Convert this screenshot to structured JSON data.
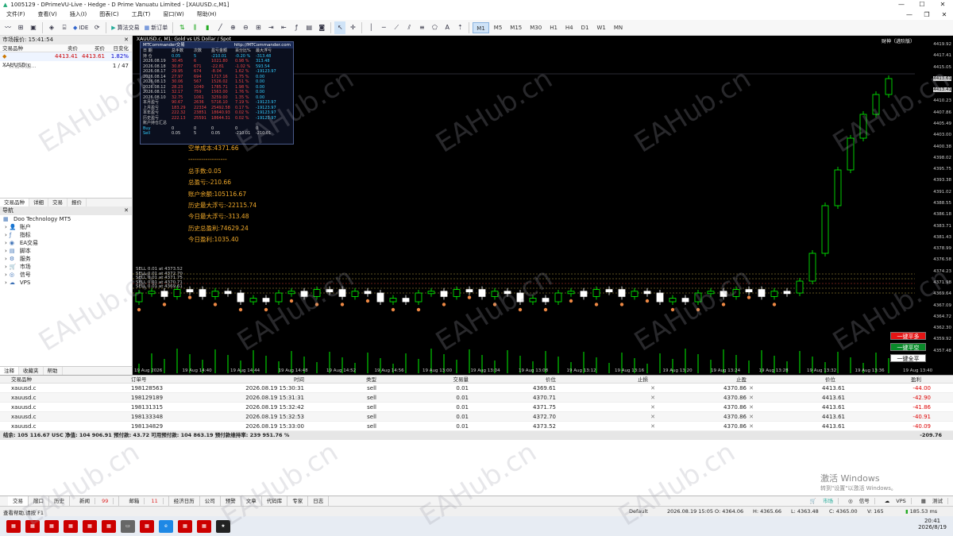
{
  "window": {
    "title": "1005129 - DPrimeVU-Live - Hedge - D Prime Vanuatu Limited - [XAUUSD.c,M1]"
  },
  "menu": [
    "文件(F)",
    "查看(V)",
    "插入(I)",
    "图表(C)",
    "工具(T)",
    "窗口(W)",
    "帮助(H)"
  ],
  "toolbar": {
    "ide": "IDE",
    "algo": "算法交易",
    "new_order": "新订单",
    "timeframes": [
      "M1",
      "M5",
      "M15",
      "M30",
      "H1",
      "H4",
      "D1",
      "W1",
      "MN"
    ]
  },
  "market_watch": {
    "header": "市场报价: 15:41:54",
    "cols": [
      "交易品种",
      "卖价",
      "买价",
      "日变化"
    ],
    "rows": [
      {
        "symbol": "XAUUSD.c",
        "bid": "4413.41",
        "ask": "4413.61",
        "change": "1.82%"
      }
    ],
    "add_label": "点击添加...",
    "count": "1 / 47",
    "tabs": [
      "交易品种",
      "详细",
      "交易",
      "报价"
    ]
  },
  "navigator": {
    "header": "导航",
    "items": [
      "Doo Technology MT5",
      "账户",
      "指标",
      "EA交易",
      "脚本",
      "服务",
      "市场",
      "信号",
      "VPS"
    ],
    "tabs": [
      "注释",
      "收藏夹",
      "帮助"
    ]
  },
  "chart": {
    "title": "XAUUSD.c, M1:  Gold vs US Dollar / Spot",
    "commander_title": "MTCommander交易",
    "commander_url": "http://MTCommander.com",
    "top_right_label": "财神（进阶版）",
    "commander_rows": [
      [
        "日 期",
        "总手数",
        "次数",
        "盈亏金额",
        "百分比%",
        "最大浮亏"
      ],
      [
        "持 仓",
        "0.05",
        "5",
        "-210.01",
        "-0.20 %",
        "-313.48"
      ],
      [
        "2026.08.19",
        "30.45",
        "6",
        "1021.80",
        "0.98 %",
        "313.48"
      ],
      [
        "2026.08.18",
        "30.87",
        "671",
        "-22.81",
        "-1.02 %",
        "593.54"
      ],
      [
        "2026.08.17",
        "29.95",
        "674",
        "-8.04",
        "1.62 %",
        "-19123.97"
      ],
      [
        "2026.08.14",
        "27.97",
        "694",
        "1717.16",
        "1.75 %",
        "0.00"
      ],
      [
        "2026.08.13",
        "30.06",
        "567",
        "1526.02",
        "1.51 %",
        "0.00"
      ],
      [
        "2026.08.12",
        "28.23",
        "1040",
        "1785.71",
        "1.98 %",
        "0.00"
      ],
      [
        "2026.08.11",
        "32.17",
        "759",
        "1563.00",
        "1.76 %",
        "0.00"
      ],
      [
        "2026.08.10",
        "32.75",
        "1061",
        "3259.00",
        "1.35 %",
        "0.00"
      ],
      [
        "本月盈亏",
        "90.67",
        "2636",
        "5716.10",
        "7.19 %",
        "-19123.97"
      ],
      [
        "上月盈亏",
        "183.29",
        "22334",
        "25492.58",
        "0.17 %",
        "-19123.97"
      ],
      [
        "本年盈亏",
        "222.32",
        "23851",
        "18640.93",
        "0.02 %",
        "-19123.97"
      ],
      [
        "历史盈亏",
        "222.13",
        "25591",
        "18644.31",
        "0.02 %",
        "-19123.97"
      ],
      [
        "账户持仓汇总",
        "",
        "",
        "",
        "",
        ""
      ],
      [
        "Buy",
        "0",
        "0",
        "0",
        "0",
        "0"
      ],
      [
        "Sell",
        "0.05",
        "5",
        "0.05",
        "-210.01",
        "-210.01"
      ]
    ],
    "summary": [
      "空单成本:4371.66",
      "------------------",
      "总手数:0.05",
      "总盈亏:-210.66",
      "账户余额:105116.67",
      "历史最大浮亏:-22115.74",
      "今日最大浮亏:-313.48",
      "历史总盈利:74629.24",
      "今日盈利:1035.40"
    ],
    "sell_tags": [
      "SELL 0.01 at 4373.52",
      "SELL 0.01 at 4372.70",
      "SELL 0.01 at 4371.75",
      "SELL 0.01 at 4370.71",
      "SELL 0.01 at 4369.61"
    ],
    "price_axis": [
      "4419.92",
      "4417.41",
      "4415.05",
      "4413.61",
      "4413.41",
      "4410.23",
      "4407.86",
      "4405.49",
      "4403.00",
      "4400.38",
      "4398.02",
      "4395.75",
      "4393.38",
      "4391.02",
      "4388.55",
      "4386.18",
      "4383.71",
      "4381.43",
      "4378.99",
      "4376.58",
      "4374.23",
      "4371.98",
      "4369.64",
      "4367.09",
      "4364.72",
      "4362.30",
      "4359.92",
      "4357.48"
    ],
    "time_axis": [
      "19 Aug 2026",
      "19 Aug 14:40",
      "19 Aug 14:44",
      "19 Aug 14:48",
      "19 Aug 14:52",
      "19 Aug 14:56",
      "19 Aug 13:00",
      "19 Aug 13:04",
      "19 Aug 13:08",
      "19 Aug 13:12",
      "19 Aug 13:16",
      "19 Aug 13:20",
      "19 Aug 13:24",
      "19 Aug 13:28",
      "19 Aug 13:32",
      "19 Aug 13:36",
      "19 Aug 13:40"
    ],
    "buttons": {
      "close_buy": "一键平多",
      "close_sell": "一键平空",
      "close_all": "一键全平"
    }
  },
  "trade": {
    "cols": [
      "交易品种",
      "订单号",
      "时间",
      "类型",
      "交易量",
      "价位",
      "止损",
      "止盈",
      "价位",
      "盈利"
    ],
    "rows": [
      [
        "xauusd.c",
        "198128563",
        "2026.08.19 15:30:31",
        "sell",
        "0.01",
        "4369.61",
        "",
        "4370.86",
        "4413.61",
        "-44.00"
      ],
      [
        "xauusd.c",
        "198129189",
        "2026.08.19 15:31:31",
        "sell",
        "0.01",
        "4370.71",
        "",
        "4370.86",
        "4413.61",
        "-42.90"
      ],
      [
        "xauusd.c",
        "198131315",
        "2026.08.19 15:32:42",
        "sell",
        "0.01",
        "4371.75",
        "",
        "4370.86",
        "4413.61",
        "-41.86"
      ],
      [
        "xauusd.c",
        "198133348",
        "2026.08.19 15:32:53",
        "sell",
        "0.01",
        "4372.70",
        "",
        "4370.86",
        "4413.61",
        "-40.91"
      ],
      [
        "xauusd.c",
        "198134829",
        "2026.08.19 15:33:00",
        "sell",
        "0.01",
        "4373.52",
        "",
        "4370.86",
        "4413.61",
        "-40.09"
      ]
    ],
    "footer": "结余: 105 116.67 USC  净值: 104 906.91  预付款: 43.72  可用预付款: 104 863.19  预付款维持率: 239 951.76 %",
    "footer_total": "-209.76"
  },
  "bottom_tabs": [
    "交易",
    "敞口",
    "历史",
    "新闻",
    "邮箱",
    "经济日历",
    "公司",
    "预警",
    "文章",
    "代码库",
    "专家",
    "日志"
  ],
  "bottom_badges": {
    "news": "99",
    "mail": "11"
  },
  "status": {
    "help": "查看帮助,请按 F1",
    "profile": "Default",
    "time": "2026.08.19 15:05",
    "open": "O: 4364.06",
    "high": "H: 4365.66",
    "low": "L: 4363.48",
    "close": "C: 4365.00",
    "volume": "V: 165",
    "ping": "185.53 ms"
  },
  "tray": {
    "market": "市场",
    "signals": "信号",
    "vps": "VPS",
    "tester": "测试"
  },
  "activate": {
    "line1": "激活 Windows",
    "line2": "转到\"设置\"以激活 Windows。"
  },
  "clock": {
    "time": "20:41",
    "date": "2026/8/19"
  },
  "watermark": "EAHub.cn"
}
